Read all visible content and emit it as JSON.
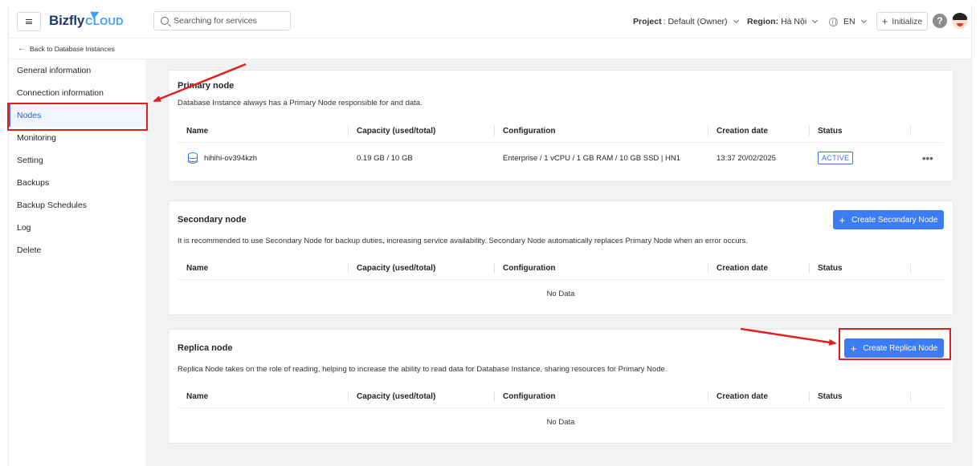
{
  "header": {
    "logo_main": "Bizfly",
    "logo_sub": "CLOUD",
    "search_placeholder": "Searching for services",
    "project_label": "Project",
    "project_value": ": Default (Owner)",
    "region_label": "Region:",
    "region_value": "Hà Nội",
    "language": "EN",
    "initialize_label": "Initialize",
    "help_symbol": "?"
  },
  "breadcrumb": {
    "back_label": "Back to Database Instances"
  },
  "sidebar": {
    "items": [
      {
        "label": "General information"
      },
      {
        "label": "Connection information"
      },
      {
        "label": "Nodes",
        "active": true
      },
      {
        "label": "Monitoring"
      },
      {
        "label": "Setting"
      },
      {
        "label": "Backups"
      },
      {
        "label": "Backup Schedules"
      },
      {
        "label": "Log"
      },
      {
        "label": "Delete"
      }
    ]
  },
  "table_columns": [
    "Name",
    "Capacity (used/total)",
    "Configuration",
    "Creation date",
    "Status"
  ],
  "primary": {
    "title": "Primary node",
    "description": "Database Instance always has a Primary Node responsible for and data.",
    "row": {
      "name": "hihihi-ov394kzh",
      "capacity": "0.19 GB / 10 GB",
      "configuration": "Enterprise / 1 vCPU / 1 GB RAM / 10 GB SSD | HN1",
      "creation_date": "13:37 20/02/2025",
      "status": "ACTIVE",
      "more": "•••"
    }
  },
  "secondary": {
    "title": "Secondary node",
    "description": "It is recommended to use Secondary Node for backup duties, increasing service availability. Secondary Node automatically replaces Primary Node when an error occurs.",
    "button_label": "Create Secondary Node",
    "empty_text": "No Data"
  },
  "replica": {
    "title": "Replica node",
    "description": "Replica Node takes on the role of reading, helping to increase the ability to read data for Database Instance, sharing resources for Primary Node.",
    "button_label": "Create Replica Node",
    "empty_text": "No Data"
  },
  "colors": {
    "accent": "#3d7cf2",
    "active_nav": "#1f5fcc",
    "annotation": "#e02020"
  }
}
